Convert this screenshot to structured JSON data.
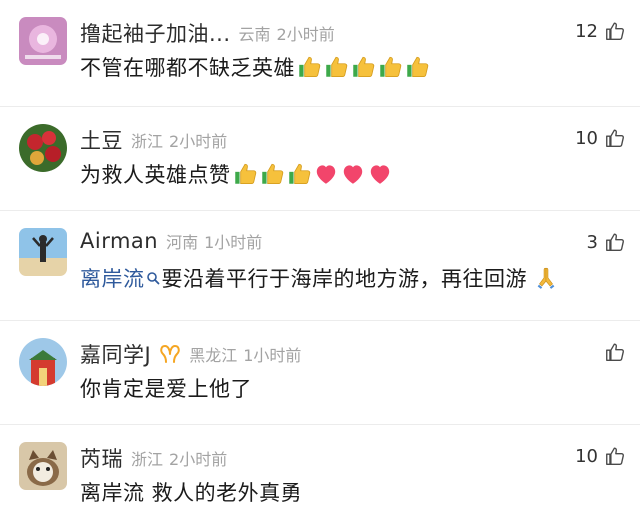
{
  "comments": [
    {
      "username": "撸起袖子加油...",
      "location": "云南",
      "time": "2小时前",
      "likes": "12",
      "text": "不管在哪都不缺乏英雄",
      "emojis": [
        "thumbs-up",
        "thumbs-up",
        "thumbs-up",
        "thumbs-up",
        "thumbs-up"
      ]
    },
    {
      "username": "土豆",
      "location": "浙江",
      "time": "2小时前",
      "likes": "10",
      "text": "为救人英雄点赞",
      "emojis": [
        "thumbs-up",
        "thumbs-up",
        "thumbs-up",
        "heart",
        "heart",
        "heart"
      ]
    },
    {
      "username": "Airman",
      "location": "河南",
      "time": "1小时前",
      "likes": "3",
      "mention": "离岸流",
      "text": "要沿着平行于海岸的地方游，再往回游",
      "emojis": [
        "praying-hands"
      ]
    },
    {
      "username": "嘉同学J",
      "location": "黑龙江",
      "time": "1小时前",
      "likes": "",
      "text": "你肯定是爱上他了",
      "emojis": []
    },
    {
      "username": "芮瑞",
      "location": "浙江",
      "time": "2小时前",
      "likes": "10",
      "text": "离岸流 救人的老外真勇",
      "emojis": []
    }
  ],
  "colors": {
    "mention": "#2f5a9c",
    "meta_gray": "#a3a3a3",
    "divider": "#ececec",
    "vip_badge": "#f5a623"
  }
}
